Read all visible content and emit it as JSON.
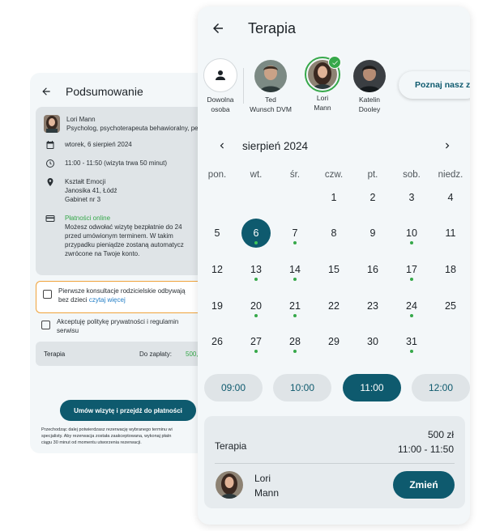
{
  "summary": {
    "title": "Podsumowanie",
    "therapist_name": "Lori Mann",
    "therapist_role": "Psycholog, psychoterapeuta behawioralny, peda",
    "date": "wtorek, 6 sierpień 2024",
    "time": "11:00 - 11:50 (wizyta trwa 50 minut)",
    "place_name": "Kształt Emocji",
    "place_street": "Janosika 41, Łódź",
    "place_room": "Gabinet nr 3",
    "payment_title": "Płatności online",
    "payment_line1": "Możesz odwołać wizytę bezpłatnie do 24",
    "payment_line2": "przed umówionym terminem. W takim",
    "payment_line3": "przypadku pieniądze zostaną automatycz",
    "payment_line4": "zwrócone na Twoje konto.",
    "consent_line1": "Pierwsze konsultacje rodzicielskie odbywają",
    "consent_line2": "bez dzieci",
    "consent_link": "czytaj więcej",
    "privacy_line1": "Akceptuję politykę prywatności i regulamin",
    "privacy_line2": "serwisu",
    "total_service": "Terapia",
    "total_label": "Do zapłaty:",
    "total_value": "500,0",
    "submit_label": "Umów wizytę i przejdź do płatności",
    "disclaimer_line1": "Przechodząc dalej potwierdzasz rezerwację wybranego terminu wi",
    "disclaimer_line2": "specjalisty. Aby rezerwacja została zaakceptowana, wykonaj płatn",
    "disclaimer_line3": "ciągu 30 minut od momentu utworzenia rezerwacji."
  },
  "therapy": {
    "title": "Terapia",
    "specialists": [
      {
        "line1": "Dowolna",
        "line2": "osoba"
      },
      {
        "line1": "Ted",
        "line2": "Wunsch DVM"
      },
      {
        "line1": "Lori",
        "line2": "Mann"
      },
      {
        "line1": "Katelin",
        "line2": "Dooley"
      }
    ],
    "meet_label": "Poznaj nasz z",
    "month_label": "sierpień 2024",
    "weekdays": [
      "pon.",
      "wt.",
      "śr.",
      "czw.",
      "pt.",
      "sob.",
      "niedz."
    ],
    "days": [
      {
        "d": "1",
        "row": 0,
        "col": 3,
        "dot": false,
        "sel": false
      },
      {
        "d": "2",
        "row": 0,
        "col": 4,
        "dot": false,
        "sel": false
      },
      {
        "d": "3",
        "row": 0,
        "col": 5,
        "dot": false,
        "sel": false
      },
      {
        "d": "4",
        "row": 0,
        "col": 6,
        "dot": false,
        "sel": false
      },
      {
        "d": "5",
        "row": 1,
        "col": 0,
        "dot": false,
        "sel": false
      },
      {
        "d": "6",
        "row": 1,
        "col": 1,
        "dot": true,
        "sel": true
      },
      {
        "d": "7",
        "row": 1,
        "col": 2,
        "dot": true,
        "sel": false
      },
      {
        "d": "8",
        "row": 1,
        "col": 3,
        "dot": false,
        "sel": false
      },
      {
        "d": "9",
        "row": 1,
        "col": 4,
        "dot": false,
        "sel": false
      },
      {
        "d": "10",
        "row": 1,
        "col": 5,
        "dot": true,
        "sel": false
      },
      {
        "d": "11",
        "row": 1,
        "col": 6,
        "dot": false,
        "sel": false
      },
      {
        "d": "12",
        "row": 2,
        "col": 0,
        "dot": false,
        "sel": false
      },
      {
        "d": "13",
        "row": 2,
        "col": 1,
        "dot": true,
        "sel": false
      },
      {
        "d": "14",
        "row": 2,
        "col": 2,
        "dot": true,
        "sel": false
      },
      {
        "d": "15",
        "row": 2,
        "col": 3,
        "dot": false,
        "sel": false
      },
      {
        "d": "16",
        "row": 2,
        "col": 4,
        "dot": false,
        "sel": false
      },
      {
        "d": "17",
        "row": 2,
        "col": 5,
        "dot": true,
        "sel": false
      },
      {
        "d": "18",
        "row": 2,
        "col": 6,
        "dot": false,
        "sel": false
      },
      {
        "d": "19",
        "row": 3,
        "col": 0,
        "dot": false,
        "sel": false
      },
      {
        "d": "20",
        "row": 3,
        "col": 1,
        "dot": true,
        "sel": false
      },
      {
        "d": "21",
        "row": 3,
        "col": 2,
        "dot": true,
        "sel": false
      },
      {
        "d": "22",
        "row": 3,
        "col": 3,
        "dot": false,
        "sel": false
      },
      {
        "d": "23",
        "row": 3,
        "col": 4,
        "dot": false,
        "sel": false
      },
      {
        "d": "24",
        "row": 3,
        "col": 5,
        "dot": true,
        "sel": false
      },
      {
        "d": "25",
        "row": 3,
        "col": 6,
        "dot": false,
        "sel": false
      },
      {
        "d": "26",
        "row": 4,
        "col": 0,
        "dot": false,
        "sel": false
      },
      {
        "d": "27",
        "row": 4,
        "col": 1,
        "dot": true,
        "sel": false
      },
      {
        "d": "28",
        "row": 4,
        "col": 2,
        "dot": true,
        "sel": false
      },
      {
        "d": "29",
        "row": 4,
        "col": 3,
        "dot": false,
        "sel": false
      },
      {
        "d": "30",
        "row": 4,
        "col": 4,
        "dot": false,
        "sel": false
      },
      {
        "d": "31",
        "row": 4,
        "col": 5,
        "dot": true,
        "sel": false
      }
    ],
    "times": [
      {
        "label": "09:00",
        "active": false
      },
      {
        "label": "10:00",
        "active": false
      },
      {
        "label": "11:00",
        "active": true
      },
      {
        "label": "12:00",
        "active": false
      }
    ],
    "booking": {
      "service": "Terapia",
      "price": "500 zł",
      "time": "11:00 - 11:50",
      "name_line1": "Lori",
      "name_line2": "Mann",
      "change_label": "Zmień"
    }
  },
  "colors": {
    "accent": "#0e5a6e",
    "available_dot": "#36a84a",
    "warning_border": "#f0a33b",
    "link": "#1f7cc5"
  },
  "icons": [
    "back-arrow-icon",
    "calendar-icon",
    "clock-icon",
    "location-pin-icon",
    "credit-card-icon",
    "person-icon",
    "check-icon",
    "chevron-left-icon",
    "chevron-right-icon"
  ]
}
